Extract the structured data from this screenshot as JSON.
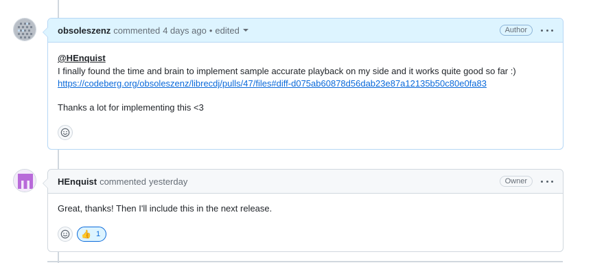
{
  "comments": [
    {
      "author": "obsoleszenz",
      "action": "commented",
      "time": "4 days ago",
      "edited_separator": "•",
      "edited_label": "edited",
      "role": "Author",
      "mention": "@HEnquist",
      "line1": "I finally found the time and brain to implement sample accurate playback on my side and it works quite good so far :)",
      "link": "https://codeberg.org/obsoleszenz/librecdj/pulls/47/files#diff-d075ab60878d56dab23e87a12135b50c80e0fa83",
      "line2": "Thanks a lot for implementing this <3"
    },
    {
      "author": "HEnquist",
      "action": "commented",
      "time": "yesterday",
      "role": "Owner",
      "text": "Great, thanks! Then I'll include this in the next release.",
      "reaction": {
        "emoji": "👍",
        "count": "1"
      }
    }
  ],
  "colors": {
    "author_header": "#ddf4ff",
    "link": "#0969da",
    "border": "#d0d7de"
  },
  "icons": [
    "smiley-icon",
    "kebab-menu-icon",
    "caret-down-icon"
  ]
}
